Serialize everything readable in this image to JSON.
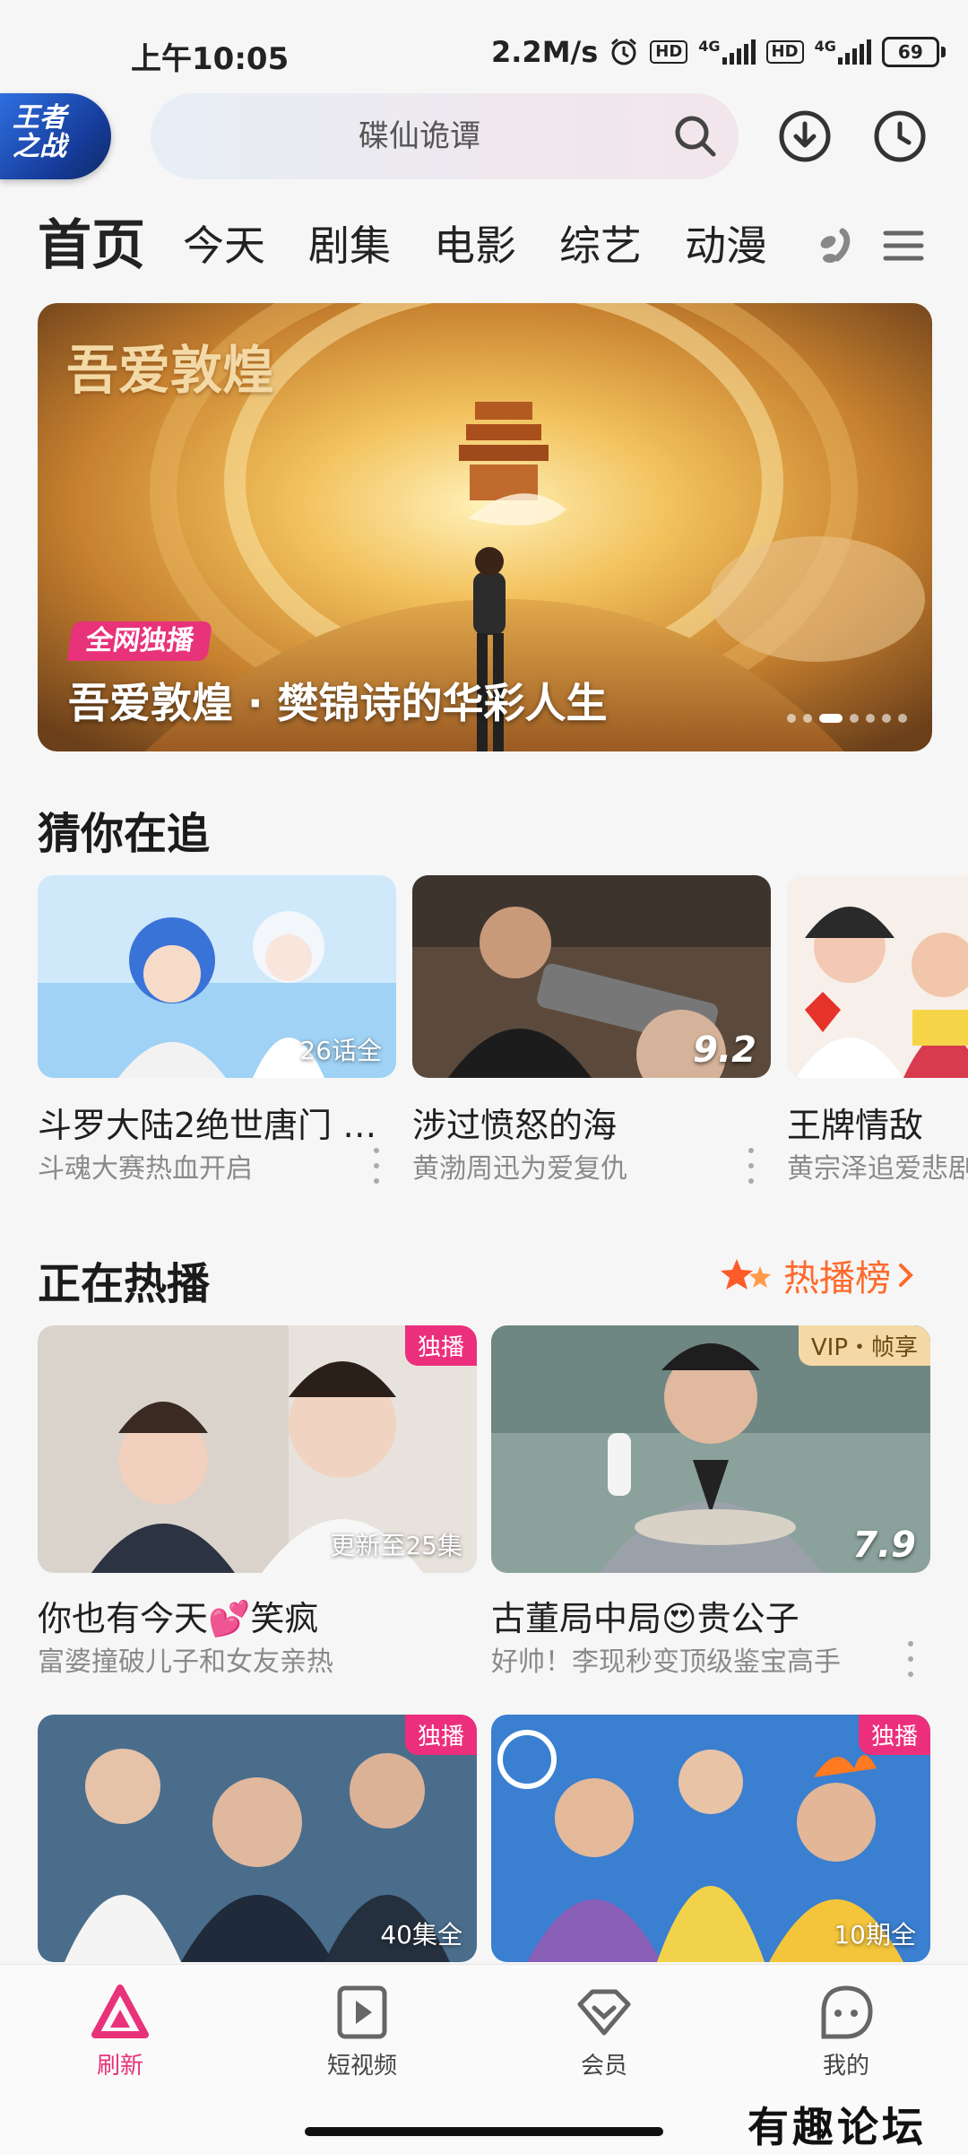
{
  "status_bar": {
    "time": "上午10:05",
    "speed": "2.2M/s",
    "hd1": "HD",
    "net1": "4G",
    "hd2": "HD",
    "net2": "4G",
    "battery": "69"
  },
  "header": {
    "logo_text": "王者之战",
    "search_placeholder": "碟仙诡谭",
    "icons": [
      "download-icon",
      "history-clock-icon",
      "search-icon"
    ]
  },
  "nav": {
    "tabs": [
      "首页",
      "今天",
      "剧集",
      "电影",
      "综艺",
      "动漫"
    ],
    "active_tab": "首页"
  },
  "banner": {
    "logo_text": "吾爱敦煌",
    "badge": "全网独播",
    "title": "吾爱敦煌 · 樊锦诗的华彩人生",
    "slide_count": 7,
    "active_slide": 3
  },
  "following": {
    "title": "猜你在追",
    "items": [
      {
        "title": "斗罗大陆2绝世唐门 …",
        "subtitle": "斗魂大赛热血开启",
        "overlay": "26话全"
      },
      {
        "title": "涉过愤怒的海",
        "subtitle": "黄渤周迅为爱复仇",
        "overlay": "9.2"
      },
      {
        "title": "王牌情敌",
        "subtitle": "黄宗泽追爱悲剧",
        "overlay": ""
      }
    ]
  },
  "hot": {
    "title": "正在热播",
    "rank_label": "热播榜",
    "items": [
      {
        "title": "你也有今天💕笑疯",
        "subtitle": "富婆撞破儿子和女友亲热",
        "overlay": "更新至25集",
        "badge": "独播"
      },
      {
        "title": "古董局中局😍贵公子",
        "subtitle": "好帅！李现秒变顶级鉴宝高手",
        "overlay": "7.9",
        "badge": "VIP・帧享"
      },
      {
        "title": "",
        "subtitle": "",
        "overlay": "40集全",
        "badge": "独播"
      },
      {
        "title": "",
        "subtitle": "",
        "overlay": "10期全",
        "badge": "独播"
      }
    ]
  },
  "bottom_nav": {
    "items": [
      {
        "label": "刷新",
        "icon": "refresh-triangle-icon",
        "active": true
      },
      {
        "label": "短视频",
        "icon": "short-video-icon",
        "active": false
      },
      {
        "label": "会员",
        "icon": "vip-diamond-icon",
        "active": false
      },
      {
        "label": "我的",
        "icon": "profile-icon",
        "active": false
      }
    ]
  },
  "watermark": "有趣论坛",
  "colors": {
    "accent": "#e8327a",
    "hot_rank": "#ff6a2c",
    "background": "#f6f6f6"
  }
}
